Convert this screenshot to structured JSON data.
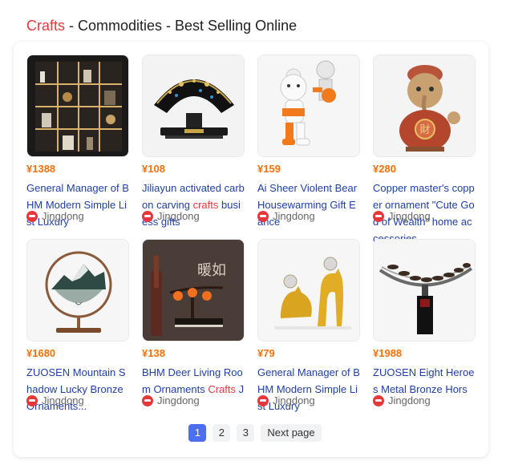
{
  "header": {
    "keyword": "Crafts",
    "rest": " - Commodities - Best Selling Online"
  },
  "products": [
    {
      "price": "¥1388",
      "name": "General Manager of BHM Modern Simple Li st Luxury",
      "shop": "Jingdong",
      "image": "bookshelf-image"
    },
    {
      "price": "¥108",
      "name_pre": "Jiliayun activated carbon carving ",
      "name_hl": "crafts",
      "name_post": " busi ess gifts",
      "shop": "Jingdong",
      "image": "fan-screen-image"
    },
    {
      "price": "¥159",
      "name": "Ai Sheer Violent Bear Housewarming Gift E ance",
      "shop": "Jingdong",
      "image": "bear-figure-image"
    },
    {
      "price": "¥280",
      "name": "Copper master's copper ornament \"Cute God of Wealth\" home ac cessories...",
      "shop": "Jingdong",
      "image": "wealth-god-image"
    },
    {
      "price": "¥1680",
      "name": "ZUOSEN Mountain Shadow Lucky Bronze Ornaments...",
      "shop": "Jingdong",
      "image": "mountain-ring-image"
    },
    {
      "price": "¥138",
      "name_pre": "BHM Deer Living Room Ornaments ",
      "name_hl": "Crafts",
      "name_post": " J",
      "shop": "Jingdong",
      "image": "persimmon-image"
    },
    {
      "price": "¥79",
      "name": "General Manager of BHM Modern Simple Li st Luxury",
      "shop": "Jingdong",
      "image": "gold-deer-image"
    },
    {
      "price": "¥1988",
      "name": "ZUOSEN Eight Heroes Metal Bronze Hors",
      "shop": "Jingdong",
      "image": "horses-sculpture-image"
    }
  ],
  "pagination": {
    "pages": [
      "1",
      "2",
      "3"
    ],
    "current": "1",
    "next_label": "Next page"
  }
}
